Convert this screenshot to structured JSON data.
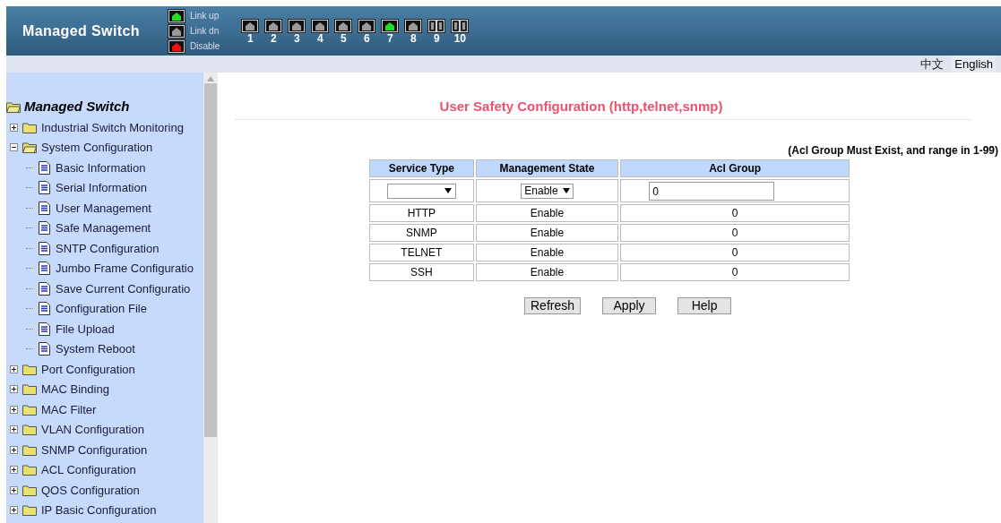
{
  "header": {
    "title": "Managed Switch",
    "legend": [
      {
        "label": "Link up",
        "color": "#22dd22"
      },
      {
        "label": "Link dn",
        "color": "#9a9a9a"
      },
      {
        "label": "Disable",
        "color": "#ee1111"
      }
    ],
    "ports": [
      {
        "label": "1",
        "kind": "copper",
        "color": "#9a9a9a"
      },
      {
        "label": "2",
        "kind": "copper",
        "color": "#9a9a9a"
      },
      {
        "label": "3",
        "kind": "copper",
        "color": "#9a9a9a"
      },
      {
        "label": "4",
        "kind": "copper",
        "color": "#9a9a9a"
      },
      {
        "label": "5",
        "kind": "copper",
        "color": "#9a9a9a"
      },
      {
        "label": "6",
        "kind": "copper",
        "color": "#9a9a9a"
      },
      {
        "label": "7",
        "kind": "copper",
        "color": "#22dd22"
      },
      {
        "label": "8",
        "kind": "copper",
        "color": "#9a9a9a"
      },
      {
        "label": "9",
        "kind": "fiber",
        "color": "#9a9a9a"
      },
      {
        "label": "10",
        "kind": "fiber",
        "color": "#9a9a9a"
      }
    ]
  },
  "languages": [
    {
      "label": "中文",
      "selected": false
    },
    {
      "label": "English",
      "selected": true
    }
  ],
  "sidebar": {
    "root": "Managed Switch",
    "items": [
      {
        "label": "Industrial Switch Monitoring",
        "expanded": false
      },
      {
        "label": "System Configuration",
        "expanded": true,
        "children": [
          {
            "label": "Basic Information",
            "kind": "page"
          },
          {
            "label": "Serial Information",
            "kind": "page"
          },
          {
            "label": "User Management",
            "kind": "page"
          },
          {
            "label": "Safe Management",
            "kind": "page"
          },
          {
            "label": "SNTP Configuration",
            "kind": "page"
          },
          {
            "label": "Jumbo Frame Configuratio",
            "kind": "page"
          },
          {
            "label": "Save Current Configuratio",
            "kind": "page"
          },
          {
            "label": "Configuration File",
            "kind": "page"
          },
          {
            "label": "File Upload",
            "kind": "page"
          },
          {
            "label": "System Reboot",
            "kind": "page"
          }
        ]
      },
      {
        "label": "Port Configuration",
        "expanded": false
      },
      {
        "label": "MAC Binding",
        "expanded": false
      },
      {
        "label": "MAC Filter",
        "expanded": false
      },
      {
        "label": "VLAN Configuration",
        "expanded": false
      },
      {
        "label": "SNMP Configuration",
        "expanded": false
      },
      {
        "label": "ACL Configuration",
        "expanded": false
      },
      {
        "label": "QOS Configuration",
        "expanded": false
      },
      {
        "label": "IP Basic Configuration",
        "expanded": false
      }
    ]
  },
  "main": {
    "title": "User Safety Configuration (http,telnet,snmp)",
    "note": "(Acl Group Must Exist, and range in 1-99)",
    "table": {
      "columns": [
        "Service Type",
        "Management State",
        "Acl Group"
      ],
      "form": {
        "management_state": "Enable",
        "acl_group": "0"
      },
      "rows": [
        [
          "HTTP",
          "Enable",
          "0"
        ],
        [
          "SNMP",
          "Enable",
          "0"
        ],
        [
          "TELNET",
          "Enable",
          "0"
        ],
        [
          "SSH",
          "Enable",
          "0"
        ]
      ]
    },
    "buttons": [
      "Refresh",
      "Apply",
      "Help"
    ]
  }
}
